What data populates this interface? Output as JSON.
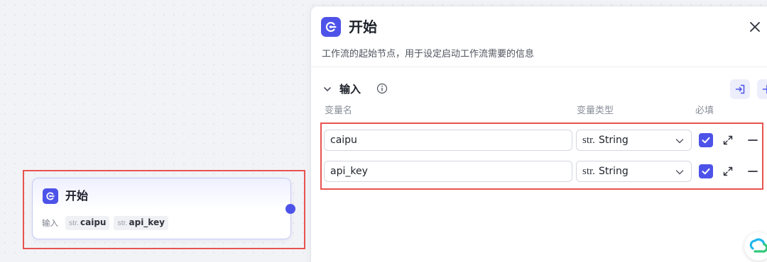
{
  "node": {
    "title": "开始",
    "inputs_label": "输入",
    "inputs": [
      {
        "type": "str.",
        "name": "caipu"
      },
      {
        "type": "str.",
        "name": "api_key"
      }
    ]
  },
  "panel": {
    "title": "开始",
    "description": "工作流的起始节点，用于设定启动工作流需要的信息",
    "section_title": "输入",
    "columns": {
      "name": "变量名",
      "type": "变量类型",
      "required": "必填"
    },
    "rows": [
      {
        "name": "caipu",
        "type_prefix": "str.",
        "type": "String",
        "required": true
      },
      {
        "name": "api_key",
        "type_prefix": "str.",
        "type": "String",
        "required": true
      }
    ]
  },
  "icons": {
    "node_icon": "start-node-icon",
    "close": "close-icon",
    "collapse": "chevron-down-icon",
    "info": "info-icon",
    "import": "import-icon",
    "add": "plus-icon",
    "expand": "expand-icon",
    "remove": "minus-icon",
    "check": "check-icon",
    "logo": "cloud-logo-icon"
  },
  "colors": {
    "accent": "#4d53e8",
    "highlight": "#e8534f"
  }
}
